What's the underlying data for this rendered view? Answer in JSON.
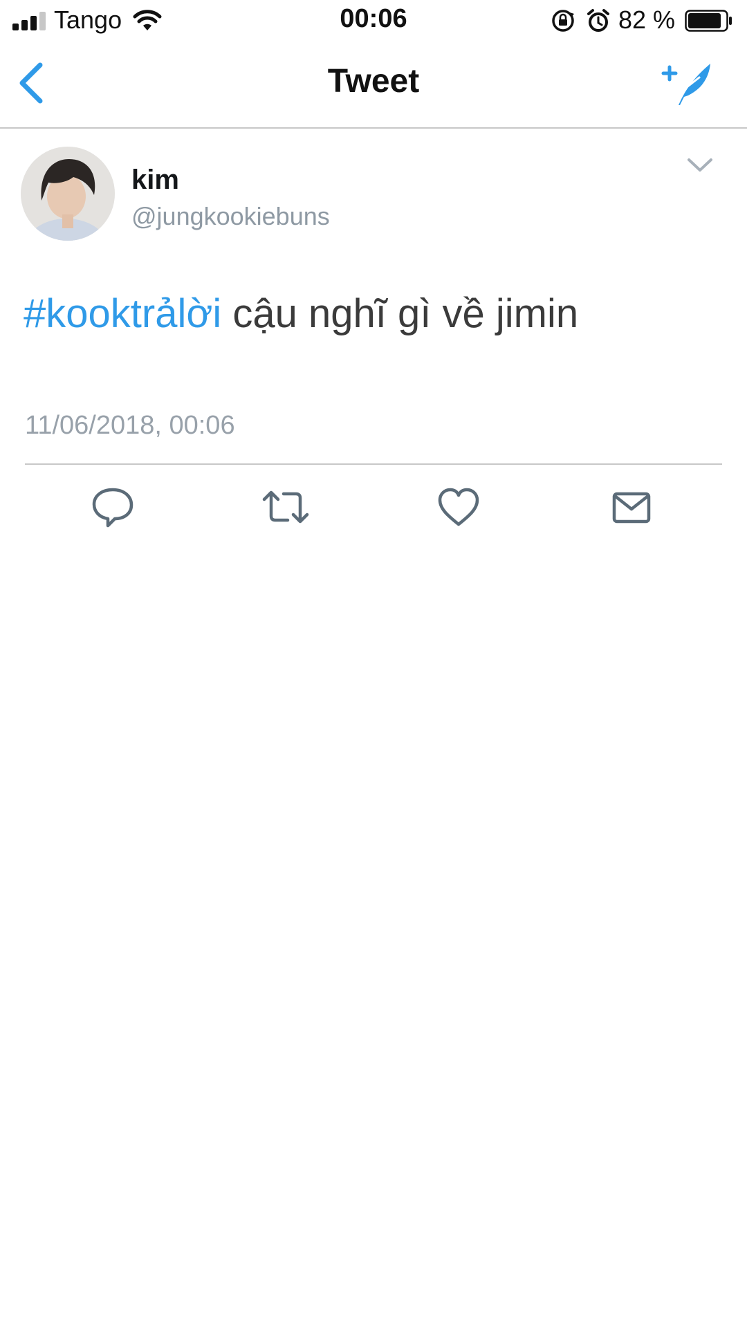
{
  "status_bar": {
    "carrier": "Tango",
    "time": "00:06",
    "battery": "82 %",
    "icons": [
      "signal-icon",
      "wifi-icon",
      "rotation-lock-icon",
      "alarm-icon",
      "battery-icon"
    ]
  },
  "nav": {
    "title": "Tweet",
    "back_icon": "chevron-left-icon",
    "compose_icon": "compose-tweet-icon"
  },
  "tweet": {
    "display_name": "kim",
    "username": "@jungkookiebuns",
    "hashtag": "#kooktrảlời",
    "text": " cậu nghĩ gì về jimin",
    "timestamp": "11/06/2018, 00:06",
    "menu_icon": "chevron-down-icon"
  },
  "actions": [
    {
      "icon": "reply-icon"
    },
    {
      "icon": "retweet-icon"
    },
    {
      "icon": "like-icon"
    },
    {
      "icon": "direct-message-icon"
    }
  ],
  "colors": {
    "accent": "#2f9ae8",
    "text": "#3b3b3b",
    "secondary_text": "#98a1aa",
    "icon": "#5b6b78",
    "divider": "#c8c8c8"
  }
}
